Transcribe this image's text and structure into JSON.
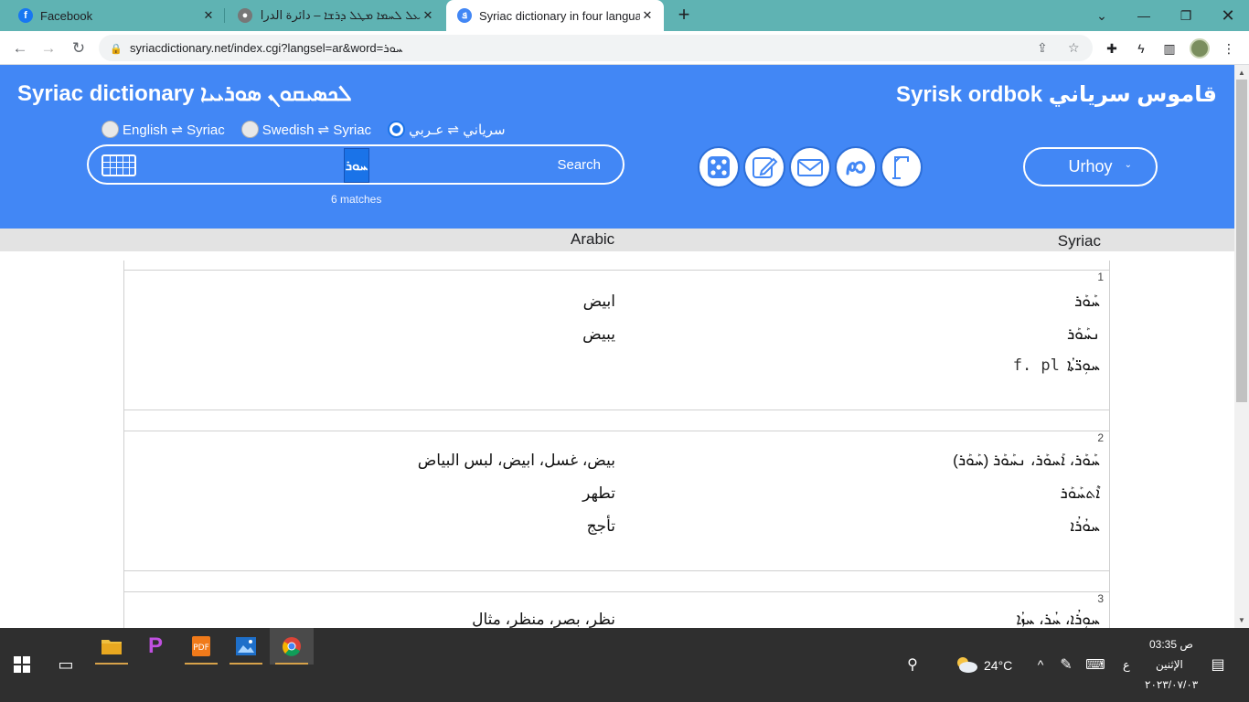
{
  "browser": {
    "tabs": [
      {
        "title": "Facebook",
        "icon": "facebook-icon",
        "active": false
      },
      {
        "title": "ܥܠ ܠܚܡܐ ܡܛܠ ܕܪܫܐ – دائرة الدراسات",
        "icon": "site-icon",
        "active": false
      },
      {
        "title": "Syriac dictionary in four languages",
        "icon": "syriac-dictionary-icon",
        "active": true
      }
    ],
    "url": "syriacdictionary.net/index.cgi?langsel=ar&word=ܚܘܪ"
  },
  "page": {
    "title_left": "Syriac dictionary ܠܟܣܝܩܘܢ ܣܘܪܝܝܐ",
    "title_right": "Syrisk ordbok قاموس سرياني",
    "radio_options": [
      {
        "label": "English ⇌ Syriac",
        "selected": false
      },
      {
        "label": "Swedish ⇌ Syriac",
        "selected": false
      },
      {
        "label": "سرياني ⇌ عـربي",
        "selected": true
      }
    ],
    "search": {
      "query": "ܚܘܪ",
      "button_label": "Search",
      "matches_text": "6 matches"
    },
    "tool_icons": [
      "dice-icon",
      "edit-icon",
      "mail-icon",
      "syriac-letter-icon",
      "gallows-icon"
    ],
    "font_selector": "Urhoy",
    "columns": {
      "arabic": "Arabic",
      "syriac": "Syriac"
    },
    "entries": [
      {
        "number": "1",
        "rows": [
          {
            "syriac": "ܚܰܘܰܪ",
            "arabic": "ابيض",
            "note": ""
          },
          {
            "syriac": "ܢܚܰܘܰܪ",
            "arabic": "يبيض",
            "note": ""
          },
          {
            "syriac": "ܚܘܼܪ̈ܬܳܐ",
            "arabic": "",
            "note": "f. pl"
          }
        ]
      },
      {
        "number": "2",
        "rows": [
          {
            "syriac": "ܚܰܘܰܪ، ܐܰܚܘܰܪ، ܢܚܰܘܰܪ (ܚܰܘܰܪ)",
            "arabic": "بيض، غسل، ابيض، لبس البياض",
            "note": ""
          },
          {
            "syriac": "ܐܶܬܚܰܘܰܪ",
            "arabic": "تطهر",
            "note": ""
          },
          {
            "syriac": "ܚܘܳܪܳܐ",
            "arabic": "تأجج",
            "note": ""
          }
        ]
      },
      {
        "number": "3",
        "rows": [
          {
            "syriac": "ܚܘܼܪܳܐ، ܚܳܪ، ܚܙܳܐ",
            "arabic": "نظر، بصر، منظر، مثال",
            "note": ""
          }
        ]
      }
    ]
  },
  "taskbar": {
    "weather": "24°C",
    "keyboard_lang": "ع",
    "time": "03:35 ص",
    "day": "الإثنين",
    "date": "٢٠٢٣/٠٧/٠٣"
  }
}
